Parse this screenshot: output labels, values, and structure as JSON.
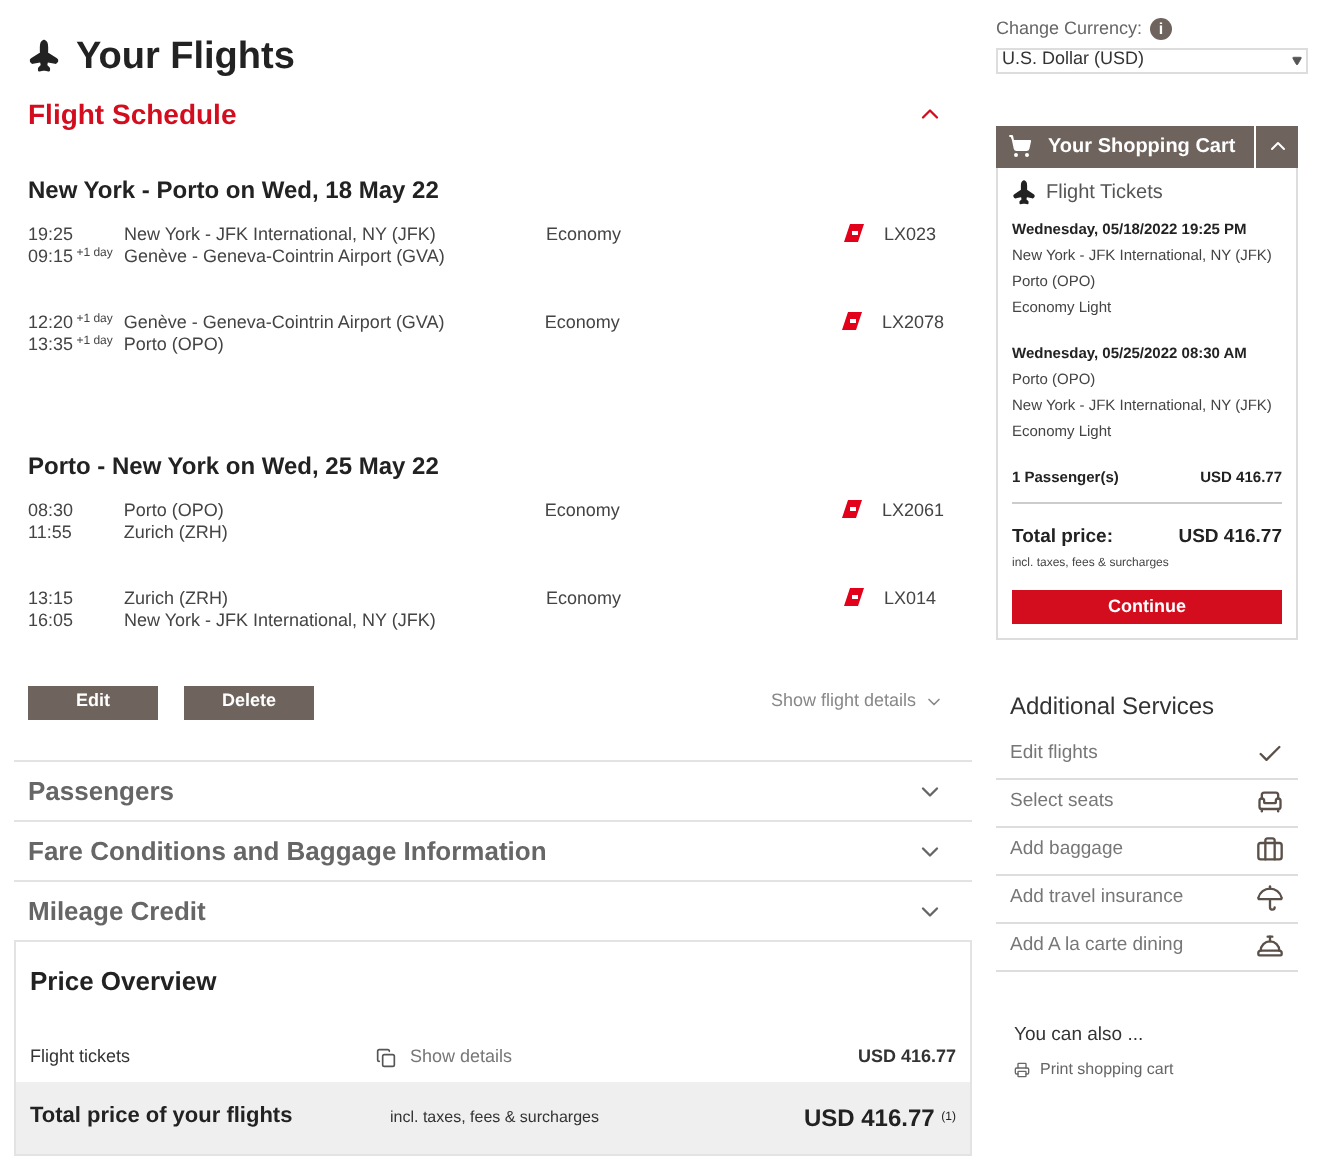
{
  "page": {
    "title": "Your Flights"
  },
  "schedule": {
    "title": "Flight Schedule",
    "expanded": true,
    "journeys": [
      {
        "title": "New York - Porto on Wed, 18 May 22",
        "segments": [
          {
            "dep_time": "19:25",
            "arr_time": "09:15",
            "arr_day": "+1 day",
            "dep_airport": "New York - JFK International, NY (JFK)",
            "arr_airport": "Genève - Geneva-Cointrin Airport (GVA)",
            "cabin": "Economy",
            "flight": "LX023"
          },
          {
            "dep_time": "12:20",
            "dep_day": "+1 day",
            "arr_time": "13:35",
            "arr_day": "+1 day",
            "dep_airport": "Genève - Geneva-Cointrin Airport (GVA)",
            "arr_airport": "Porto (OPO)",
            "cabin": "Economy",
            "flight": "LX2078"
          }
        ]
      },
      {
        "title": "Porto - New York on Wed, 25 May 22",
        "segments": [
          {
            "dep_time": "08:30",
            "arr_time": "11:55",
            "dep_airport": "Porto (OPO)",
            "arr_airport": "Zurich (ZRH)",
            "cabin": "Economy",
            "flight": "LX2061"
          },
          {
            "dep_time": "13:15",
            "arr_time": "16:05",
            "dep_airport": "Zurich (ZRH)",
            "arr_airport": "New York - JFK International, NY (JFK)",
            "cabin": "Economy",
            "flight": "LX014"
          }
        ]
      }
    ],
    "buttons": [
      "Edit",
      "Delete"
    ],
    "details_link": "Show flight details"
  },
  "sections": [
    {
      "title": "Passengers",
      "expanded": false
    },
    {
      "title": "Fare Conditions and Baggage Information",
      "expanded": false
    },
    {
      "title": "Mileage Credit",
      "expanded": false
    }
  ],
  "price_overview": {
    "title": "Price Overview",
    "tickets_label": "Flight tickets",
    "details_link": "Show details",
    "tickets_price": "USD 416.77",
    "total_label": "Total price of your flights",
    "total_note": "incl. taxes, fees & surcharges",
    "total_price": "USD 416.77",
    "footnote": "(1)"
  },
  "currency": {
    "label": "Change Currency:",
    "info": "i",
    "value": "U.S. Dollar (USD)"
  },
  "cart": {
    "title": "Your Shopping Cart",
    "expanded": true,
    "section": "Flight Tickets",
    "flights": [
      {
        "date": "Wednesday, 05/18/2022 19:25 PM",
        "from": "New York - JFK International, NY (JFK)",
        "to": "Porto (OPO)",
        "fare": "Economy Light"
      },
      {
        "date": "Wednesday, 05/25/2022 08:30 AM",
        "from": "Porto (OPO)",
        "to": "New York - JFK International, NY (JFK)",
        "fare": "Economy Light"
      }
    ],
    "passengers": "1 Passenger(s)",
    "passengers_price": "USD 416.77",
    "total_label": "Total price:",
    "total_price": "USD 416.77",
    "total_note": "incl. taxes, fees & surcharges",
    "button": "Continue"
  },
  "services": {
    "title": "Additional Services",
    "items": [
      {
        "label": "Edit flights",
        "kind": "check"
      },
      {
        "label": "Select seats",
        "kind": "seat"
      },
      {
        "label": "Add baggage",
        "kind": "baggage"
      },
      {
        "label": "Add travel insurance",
        "kind": "umbrella"
      },
      {
        "label": "Add A la carte dining",
        "kind": "dining"
      }
    ]
  },
  "also": {
    "title": "You can also ...",
    "link": "Print shopping cart"
  }
}
